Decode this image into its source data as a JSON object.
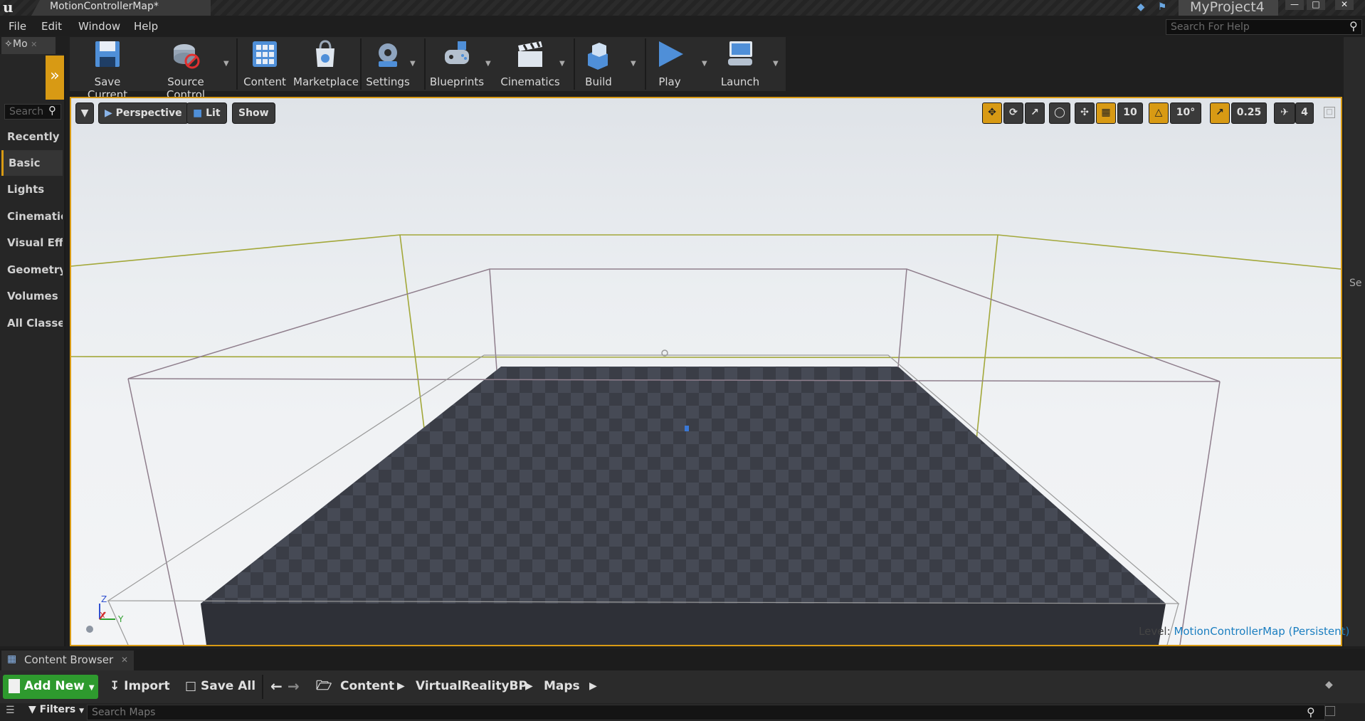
{
  "window": {
    "document_tab": "MotionControllerMap*",
    "project_name": "MyProject4"
  },
  "menu": {
    "items": [
      "File",
      "Edit",
      "Window",
      "Help"
    ],
    "help_search_placeholder": "Search For Help"
  },
  "modes": {
    "tab_label": "Mo",
    "search_placeholder": "Search",
    "categories": [
      "Recently Placed",
      "Basic",
      "Lights",
      "Cinematic",
      "Visual Effects",
      "Geometry",
      "Volumes",
      "All Classes"
    ],
    "active_category": "Basic"
  },
  "toolbar": {
    "buttons": [
      {
        "label": "Save Current",
        "icon": "save-icon"
      },
      {
        "label": "Source Control",
        "icon": "source-control-icon"
      },
      {
        "label": "Content",
        "icon": "content-icon"
      },
      {
        "label": "Marketplace",
        "icon": "marketplace-icon"
      },
      {
        "label": "Settings",
        "icon": "settings-icon"
      },
      {
        "label": "Blueprints",
        "icon": "blueprints-icon"
      },
      {
        "label": "Cinematics",
        "icon": "cinematics-icon"
      },
      {
        "label": "Build",
        "icon": "build-icon"
      },
      {
        "label": "Play",
        "icon": "play-icon"
      },
      {
        "label": "Launch",
        "icon": "launch-icon"
      }
    ]
  },
  "viewport": {
    "view_mode": "Perspective",
    "lighting": "Lit",
    "show_label": "Show",
    "grid_snap": "10",
    "rotation_snap": "10°",
    "scale_snap": "0.25",
    "camera_speed": "4",
    "level_prefix": "Level:",
    "level_name": "MotionControllerMap (Persistent)",
    "axis_labels": {
      "z": "Z",
      "x": "X",
      "y": "Y"
    },
    "right_panel_label": "Se"
  },
  "content_browser": {
    "tab_label": "Content Browser",
    "add_new": "Add New",
    "import": "Import",
    "save_all": "Save All",
    "breadcrumb": [
      "Content",
      "VirtualRealityBP",
      "Maps"
    ],
    "filters": "Filters",
    "search_placeholder": "Search Maps"
  },
  "colors": {
    "accent": "#d89a14",
    "add_new_green": "#2e9a2e",
    "level_link": "#1a7ec0"
  }
}
